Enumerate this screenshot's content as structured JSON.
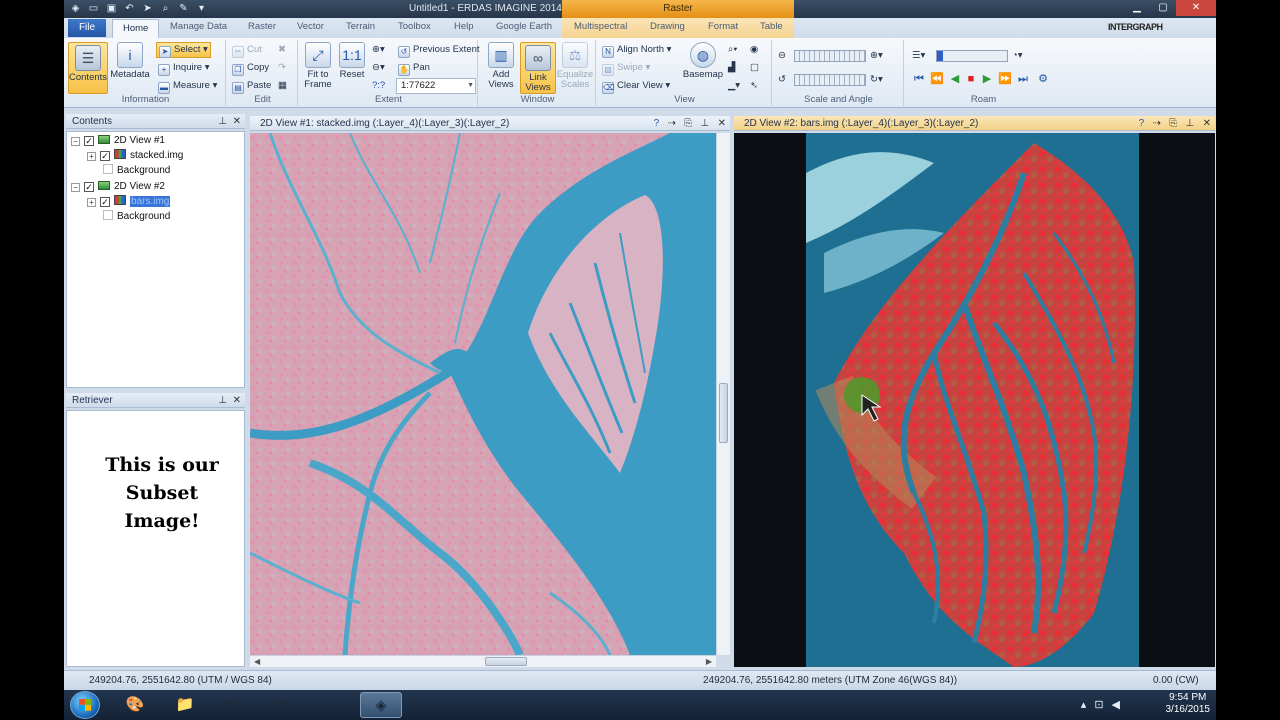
{
  "window": {
    "title": "Untitled1 - ERDAS IMAGINE 2014",
    "context_tab": "Raster",
    "vendor": "INTERGRAPH"
  },
  "tabs": [
    "File",
    "Home",
    "Manage Data",
    "Raster",
    "Vector",
    "Terrain",
    "Toolbox",
    "Help",
    "Google Earth",
    "Multispectral",
    "Drawing",
    "Format",
    "Table"
  ],
  "ribbon": {
    "information": {
      "label": "Information",
      "contents": "Contents",
      "metadata": "Metadata",
      "select": "Select",
      "inquire": "Inquire",
      "measure": "Measure"
    },
    "edit": {
      "label": "Edit",
      "cut": "Cut",
      "copy": "Copy",
      "paste": "Paste"
    },
    "extent": {
      "label": "Extent",
      "fit_to_frame": "Fit to Frame",
      "reset": "Reset",
      "previous_extent": "Previous Extent",
      "pan": "Pan",
      "scale_value": "1:77622",
      "scale_prefix": "?:?"
    },
    "window": {
      "label": "Window",
      "add_views": "Add Views",
      "link_views": "Link Views",
      "equalize_scales": "Equalize Scales"
    },
    "view": {
      "label": "View",
      "align_north": "Align North",
      "swipe": "Swipe",
      "clear_view": "Clear View",
      "basemap": "Basemap"
    },
    "scale_angle": {
      "label": "Scale and Angle"
    },
    "roam": {
      "label": "Roam"
    }
  },
  "contents_panel": {
    "title": "Contents",
    "items": [
      {
        "label": "2D View #1"
      },
      {
        "label": "stacked.img"
      },
      {
        "label": "Background"
      },
      {
        "label": "2D View #2"
      },
      {
        "label": "bars.img"
      },
      {
        "label": "Background"
      }
    ]
  },
  "retriever_panel": {
    "title": "Retriever",
    "text_line1": "This is our",
    "text_line2": "Subset",
    "text_line3": "Image!"
  },
  "views": {
    "view1_title": "2D View #1: stacked.img (:Layer_4)(:Layer_3)(:Layer_2)",
    "view2_title": "2D View #2: bars.img (:Layer_4)(:Layer_3)(:Layer_2)"
  },
  "status": {
    "coords_left": "249204.76, 2551642.80  (UTM / WGS 84)",
    "coords_right": "249204.76, 2551642.80 meters (UTM Zone 46(WGS 84))",
    "rotation": "0.00 (CW)"
  },
  "taskbar": {
    "time": "9:54 PM",
    "date": "3/16/2015"
  },
  "colors": {
    "accent": "#2356a8",
    "context_tab": "#f0a52e",
    "water": "#3d9cc4",
    "land_pink": "#d99fb2",
    "vegetation_red": "#e8323c"
  }
}
